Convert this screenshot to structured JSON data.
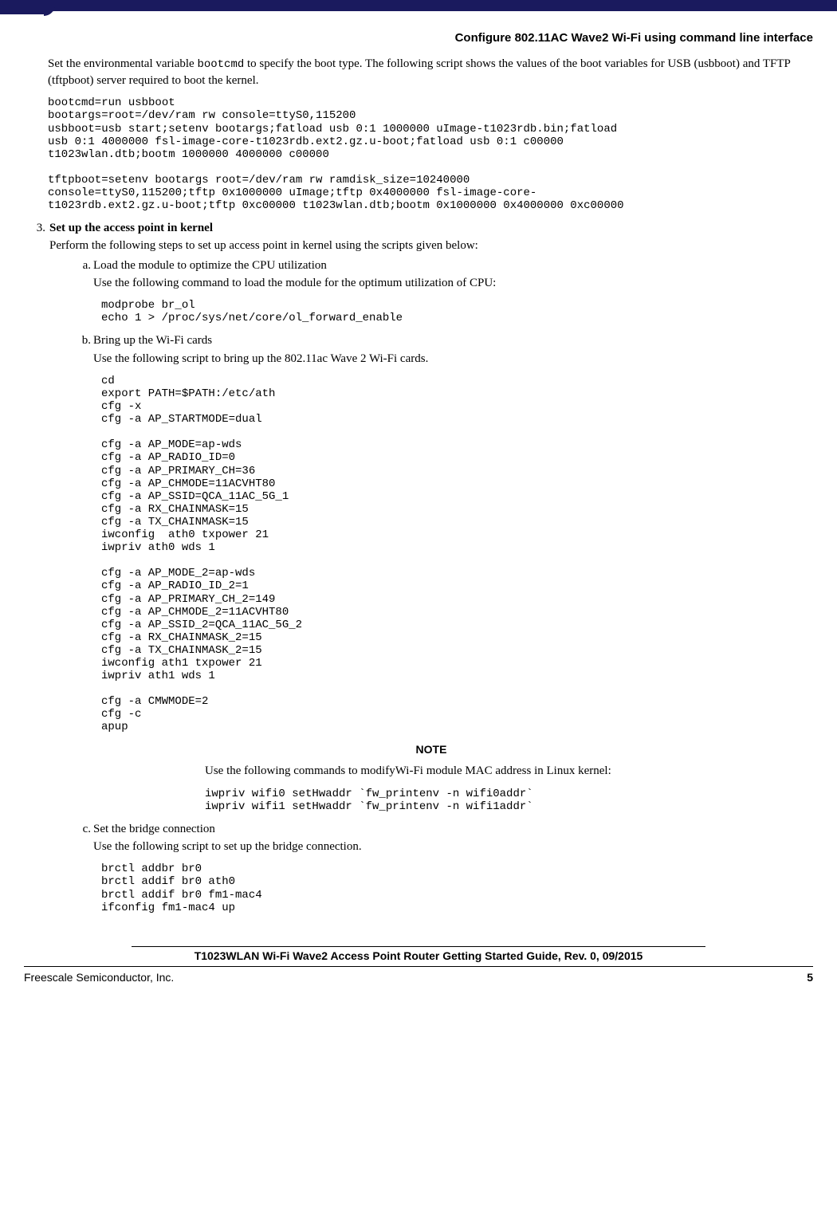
{
  "header": {
    "title": "Configure 802.11AC Wave2 Wi-Fi using command line interface"
  },
  "intro": {
    "paragraph_prefix": "Set the environmental variable ",
    "paragraph_code": "bootcmd",
    "paragraph_suffix": " to specify the boot type. The following script shows the values of the boot variables for USB (usbboot) and TFTP (tftpboot) server required to boot the kernel.",
    "code": "bootcmd=run usbboot\nbootargs=root=/dev/ram rw console=ttyS0,115200\nusbboot=usb start;setenv bootargs;fatload usb 0:1 1000000 uImage-t1023rdb.bin;fatload\nusb 0:1 4000000 fsl-image-core-t1023rdb.ext2.gz.u-boot;fatload usb 0:1 c00000\nt1023wlan.dtb;bootm 1000000 4000000 c00000\n\ntftpboot=setenv bootargs root=/dev/ram rw ramdisk_size=10240000\nconsole=ttyS0,115200;tftp 0x1000000 uImage;tftp 0x4000000 fsl-image-core-\nt1023rdb.ext2.gz.u-boot;tftp 0xc00000 t1023wlan.dtb;bootm 0x1000000 0x4000000 0xc00000"
  },
  "step3": {
    "marker": "3.",
    "title": "Set up the access point in kernel",
    "intro": "Perform the following steps to set up access point in kernel using the scripts given below:",
    "a": {
      "marker": "a.",
      "title": "Load the module to optimize the CPU utilization",
      "desc": "Use the following command to load the module for the optimum utilization of CPU:",
      "code": "modprobe br_ol\necho 1 > /proc/sys/net/core/ol_forward_enable"
    },
    "b": {
      "marker": "b.",
      "title": "Bring up the Wi-Fi cards",
      "desc": "Use the following script to bring up the 802.11ac Wave 2 Wi-Fi cards.",
      "code": "cd\nexport PATH=$PATH:/etc/ath\ncfg -x\ncfg -a AP_STARTMODE=dual\n\ncfg -a AP_MODE=ap-wds\ncfg -a AP_RADIO_ID=0\ncfg -a AP_PRIMARY_CH=36\ncfg -a AP_CHMODE=11ACVHT80\ncfg -a AP_SSID=QCA_11AC_5G_1\ncfg -a RX_CHAINMASK=15\ncfg -a TX_CHAINMASK=15\niwconfig  ath0 txpower 21\niwpriv ath0 wds 1\n\ncfg -a AP_MODE_2=ap-wds\ncfg -a AP_RADIO_ID_2=1\ncfg -a AP_PRIMARY_CH_2=149\ncfg -a AP_CHMODE_2=11ACVHT80\ncfg -a AP_SSID_2=QCA_11AC_5G_2\ncfg -a RX_CHAINMASK_2=15\ncfg -a TX_CHAINMASK_2=15\niwconfig ath1 txpower 21\niwpriv ath1 wds 1\n\ncfg -a CMWMODE=2\ncfg -c\napup",
      "note": {
        "label": "NOTE",
        "text": "Use the following commands to modifyWi-Fi module MAC address in Linux kernel:",
        "code": "iwpriv wifi0 setHwaddr `fw_printenv -n wifi0addr`\niwpriv wifi1 setHwaddr `fw_printenv -n wifi1addr`"
      }
    },
    "c": {
      "marker": "c.",
      "title": "Set the bridge connection",
      "desc": "Use the following script to set up the bridge connection.",
      "code": "brctl addbr br0\nbrctl addif br0 ath0\nbrctl addif br0 fm1-mac4\nifconfig fm1-mac4 up"
    }
  },
  "footer": {
    "doc_title": "T1023WLAN Wi-Fi Wave2 Access Point Router Getting Started Guide, Rev. 0, 09/2015",
    "left": "Freescale Semiconductor, Inc.",
    "page": "5"
  }
}
